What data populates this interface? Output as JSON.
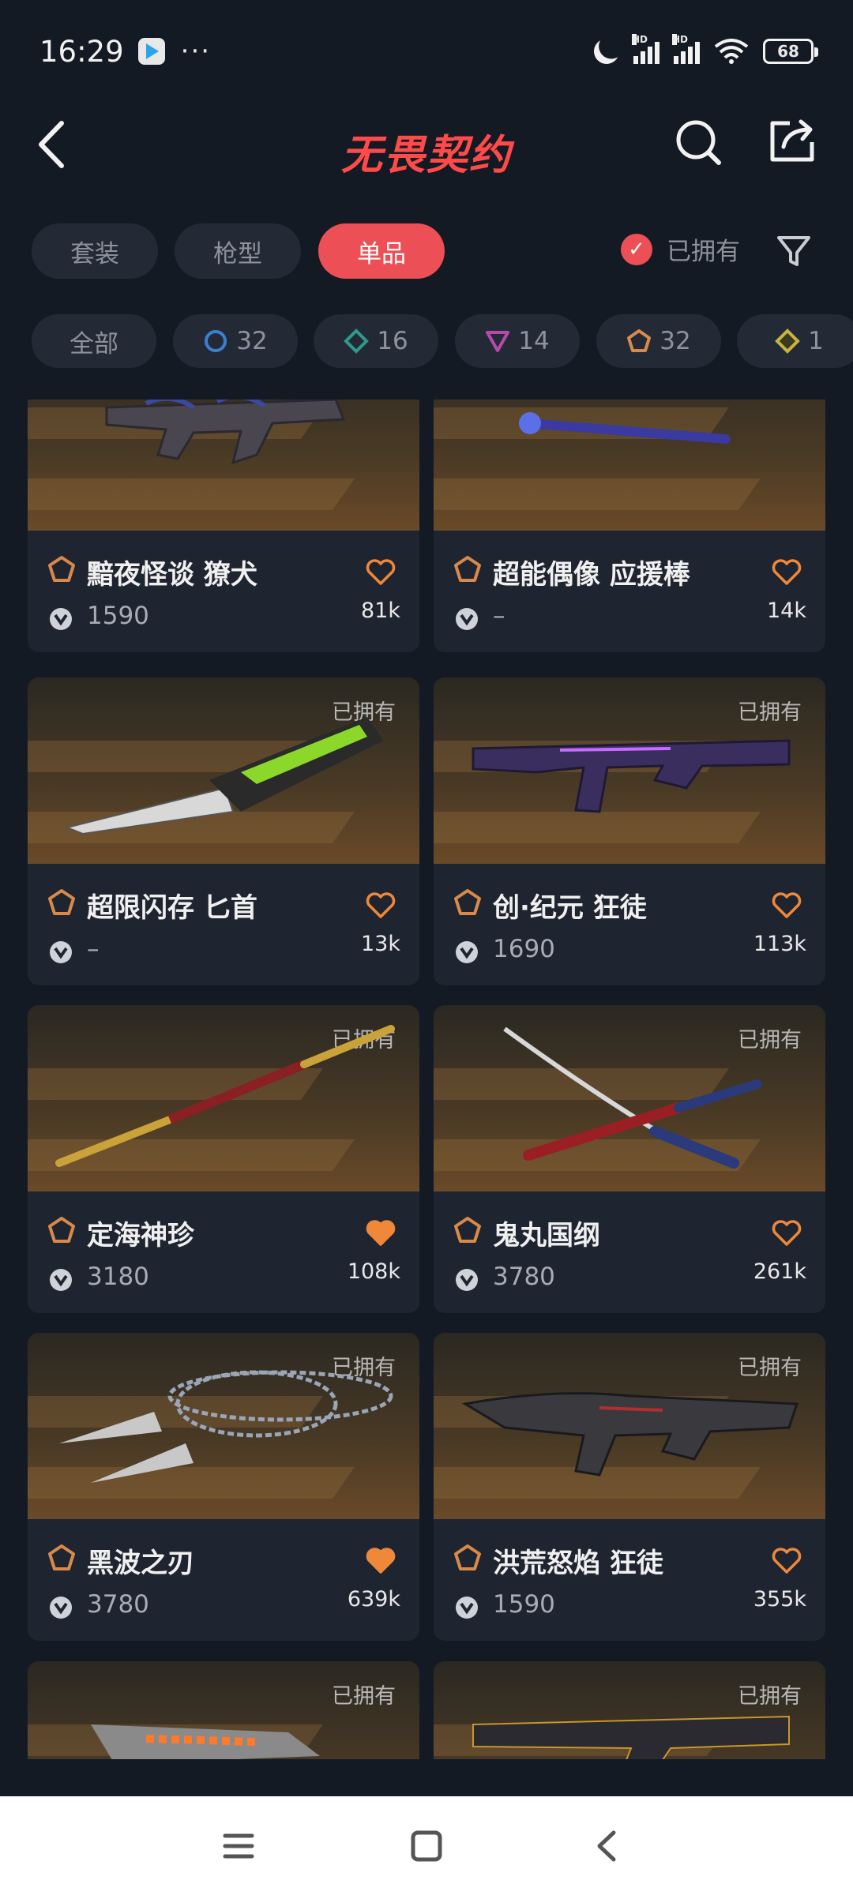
{
  "status_bar": {
    "time": "16:29",
    "more": "···",
    "battery": "68",
    "network_label": "HD"
  },
  "header": {
    "title": "无畏契约"
  },
  "tabs": [
    {
      "label": "套装",
      "active": false
    },
    {
      "label": "枪型",
      "active": false
    },
    {
      "label": "单品",
      "active": true
    }
  ],
  "owned_filter": {
    "label": "已拥有",
    "checked": true
  },
  "rarity_filters": [
    {
      "label": "全部"
    },
    {
      "count": "32",
      "icon": "select-tier-icon",
      "color": "#3c7fd1"
    },
    {
      "count": "16",
      "icon": "deluxe-tier-icon",
      "color": "#2e9a8a"
    },
    {
      "count": "14",
      "icon": "premium-tier-icon",
      "color": "#b64aa8"
    },
    {
      "count": "32",
      "icon": "exclusive-tier-icon",
      "color": "#d98a4a"
    },
    {
      "count": "1",
      "icon": "ultra-tier-icon",
      "color": "#c8b440"
    }
  ],
  "items": [
    {
      "name": "黯夜怪谈 獠犬",
      "price": "1590",
      "likes": "81k",
      "owned": false,
      "favorited": false,
      "owned_label": ""
    },
    {
      "name": "超能偶像 应援棒",
      "price": "–",
      "likes": "14k",
      "owned": false,
      "favorited": false,
      "owned_label": ""
    },
    {
      "name": "超限闪存 匕首",
      "price": "–",
      "likes": "13k",
      "owned": true,
      "favorited": false,
      "owned_label": "已拥有"
    },
    {
      "name": "创·纪元 狂徒",
      "price": "1690",
      "likes": "113k",
      "owned": true,
      "favorited": false,
      "owned_label": "已拥有"
    },
    {
      "name": "定海神珍",
      "price": "3180",
      "likes": "108k",
      "owned": true,
      "favorited": true,
      "owned_label": "已拥有"
    },
    {
      "name": "鬼丸国纲",
      "price": "3780",
      "likes": "261k",
      "owned": true,
      "favorited": false,
      "owned_label": "已拥有"
    },
    {
      "name": "黑波之刃",
      "price": "3780",
      "likes": "639k",
      "owned": true,
      "favorited": true,
      "owned_label": "已拥有"
    },
    {
      "name": "洪荒怒焰 狂徒",
      "price": "1590",
      "likes": "355k",
      "owned": true,
      "favorited": false,
      "owned_label": "已拥有"
    },
    {
      "owned": true,
      "owned_label": "已拥有"
    },
    {
      "owned": true,
      "owned_label": "已拥有"
    }
  ],
  "colors": {
    "accent": "#ec4f55",
    "heart": "#f0883a",
    "background": "#141a24",
    "card": "#1f2530"
  }
}
